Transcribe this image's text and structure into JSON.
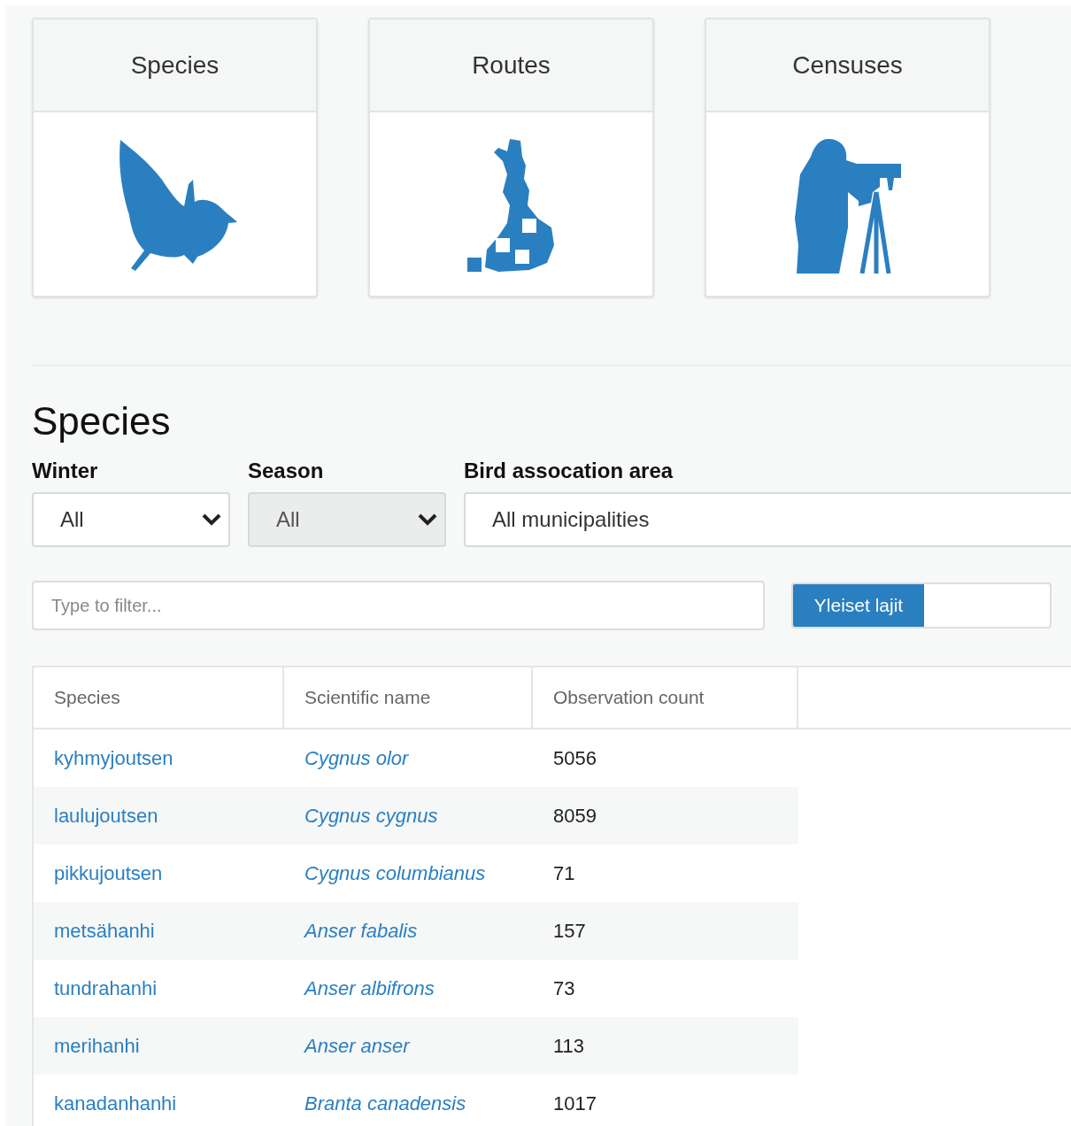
{
  "cards": [
    {
      "title": "Species",
      "kind": "bird"
    },
    {
      "title": "Routes",
      "kind": "map"
    },
    {
      "title": "Censuses",
      "kind": "observer"
    }
  ],
  "heading": "Species",
  "filters": [
    {
      "label": "Winter",
      "value": "All",
      "kind": "select",
      "disabled": false
    },
    {
      "label": "Season",
      "value": "All",
      "kind": "select",
      "disabled": true
    },
    {
      "label": "Bird assocation area",
      "value": "All municipalities",
      "kind": "input",
      "disabled": false
    }
  ],
  "search": {
    "placeholder": "Type to filter..."
  },
  "toggle": {
    "options": [
      {
        "label": "Yleiset lajit",
        "selected": true
      }
    ]
  },
  "table": {
    "columns": [
      "Species",
      "Scientific name",
      "Observation count"
    ],
    "rows": [
      [
        "kyhmyjoutsen",
        "Cygnus olor",
        "5056"
      ],
      [
        "laulujoutsen",
        "Cygnus cygnus",
        "8059"
      ],
      [
        "pikkujoutsen",
        "Cygnus columbianus",
        "71"
      ],
      [
        "metsähanhi",
        "Anser fabalis",
        "157"
      ],
      [
        "tundrahanhi",
        "Anser albifrons",
        "73"
      ],
      [
        "merihanhi",
        "Anser anser",
        "113"
      ],
      [
        "kanadanhanhi",
        "Branta canadensis",
        "1017"
      ]
    ]
  }
}
